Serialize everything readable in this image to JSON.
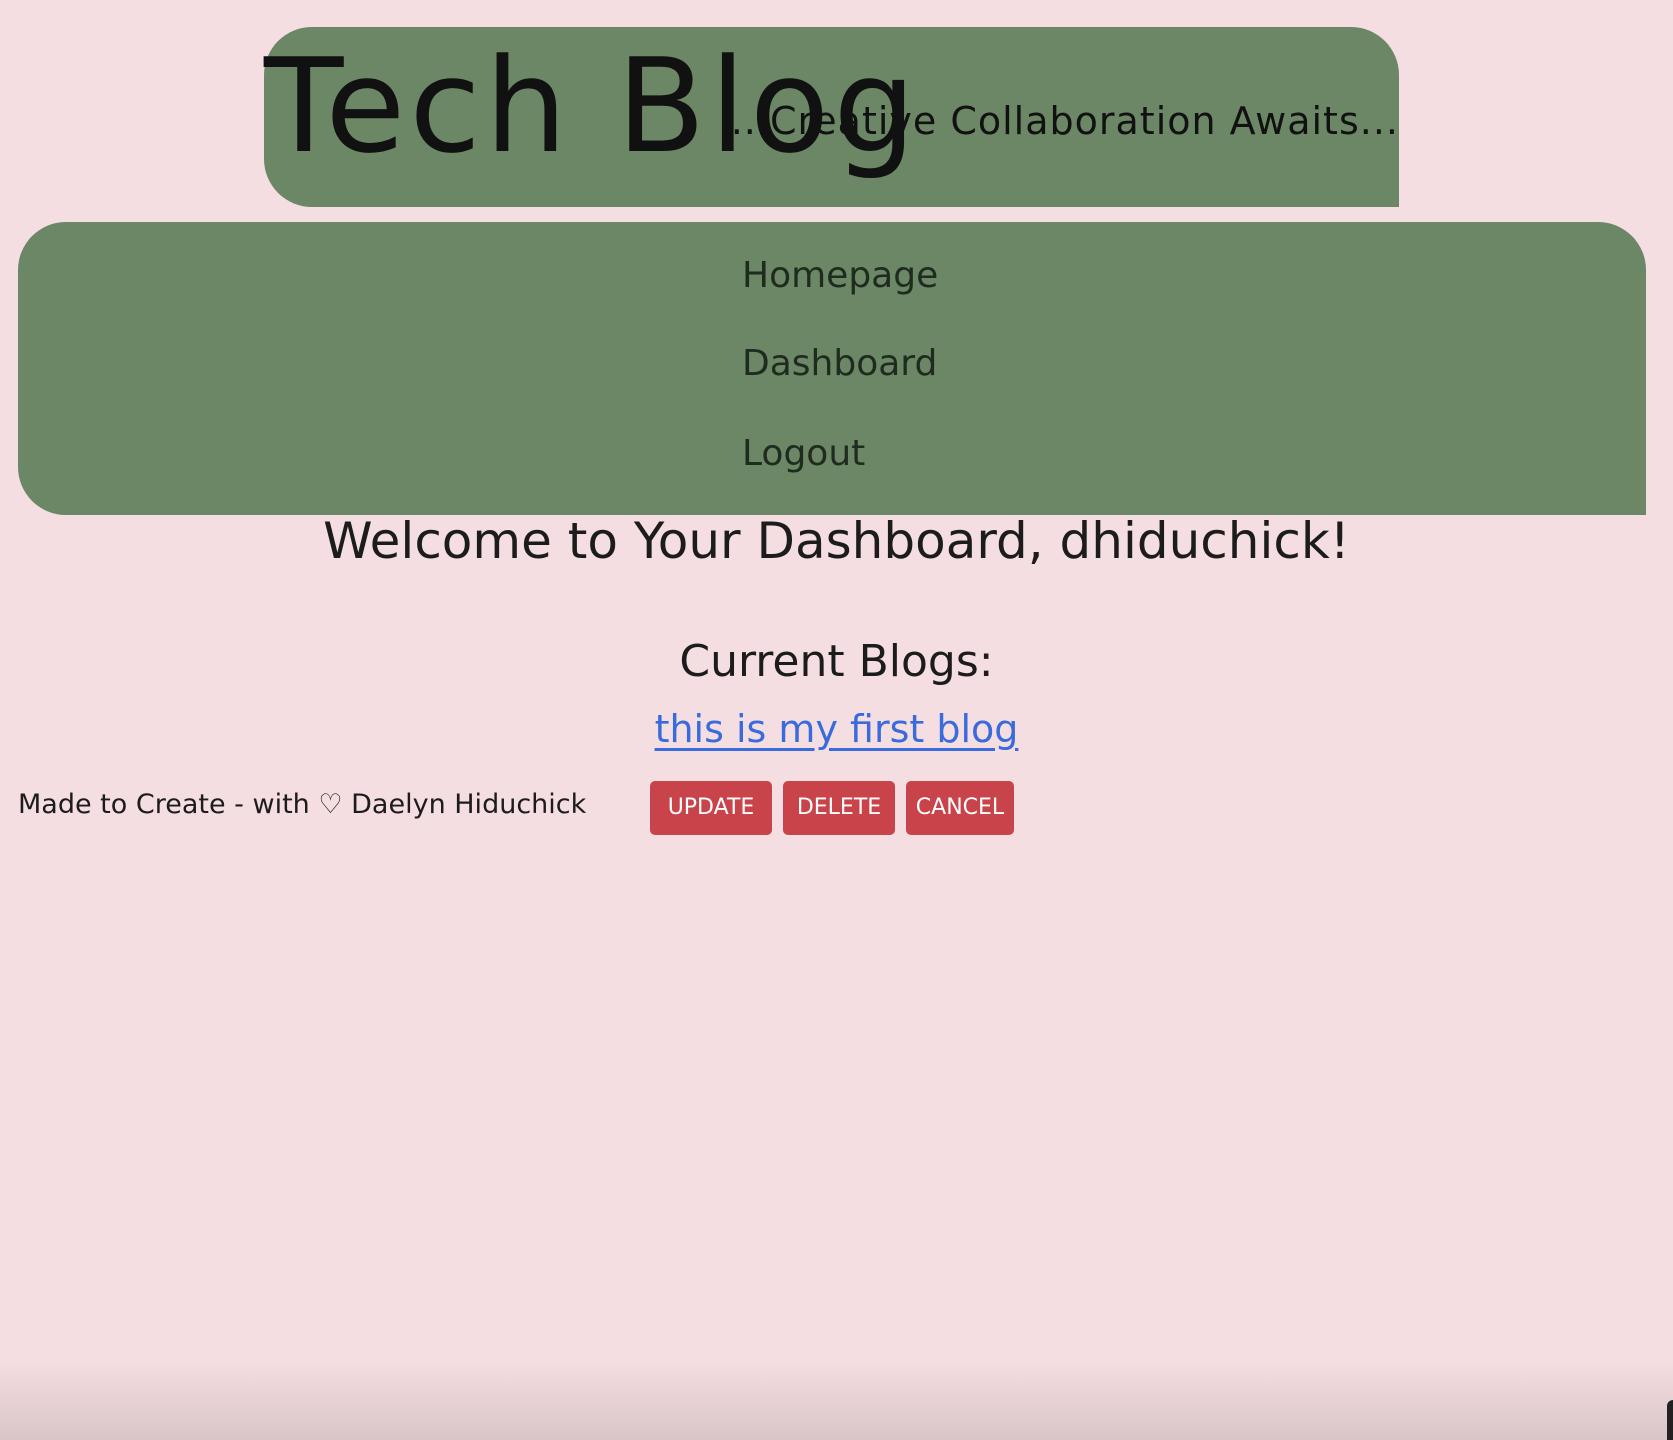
{
  "header": {
    "title": "Tech Blog",
    "tagline": "...Creative Collaboration Awaits..."
  },
  "nav": {
    "items": [
      {
        "label": "Homepage"
      },
      {
        "label": "Dashboard"
      },
      {
        "label": "Logout"
      }
    ]
  },
  "main": {
    "welcome": "Welcome to Your Dashboard, dhiduchick!",
    "current_heading": "Current Blogs:",
    "blogs": [
      {
        "title": "this is my first blog"
      }
    ],
    "actions": {
      "update_label": "UPDATE",
      "delete_label": "DELETE",
      "cancel_label": "CANCEL"
    }
  },
  "footer": {
    "credit": "Made to Create - with ♡ Daelyn Hiduchick"
  },
  "colors": {
    "background": "#f5dee2",
    "header_green": "#6b8765",
    "button_red": "#c9434a",
    "link_blue": "#3a6bdc"
  }
}
